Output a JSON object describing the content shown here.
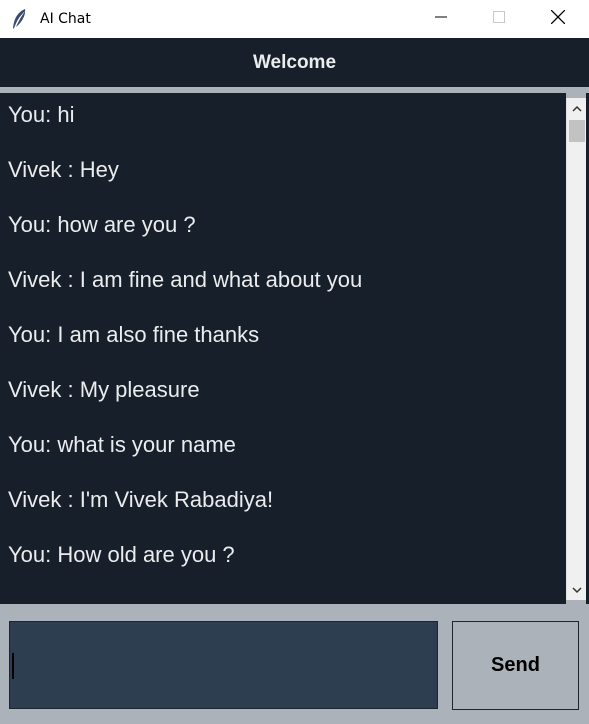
{
  "window": {
    "title": "AI Chat",
    "icon": "feather-icon",
    "controls": [
      "minimize-icon",
      "maximize-icon",
      "close-icon"
    ]
  },
  "header": {
    "title": "Welcome"
  },
  "chat": {
    "messages": [
      "You: hi",
      "Vivek : Hey",
      "You: how are you ?",
      "Vivek : I am fine and what about you",
      "You: I am also fine thanks",
      "Vivek : My pleasure",
      "You: what is your name",
      "Vivek : I'm Vivek Rabadiya!",
      "You: How old are you ?"
    ]
  },
  "input": {
    "value": ""
  },
  "send": {
    "label": "Send"
  },
  "colors": {
    "background": "#ABB2B9",
    "chat_bg": "#17202A",
    "text": "#EAECEE",
    "input_bg": "#2C3E50"
  }
}
